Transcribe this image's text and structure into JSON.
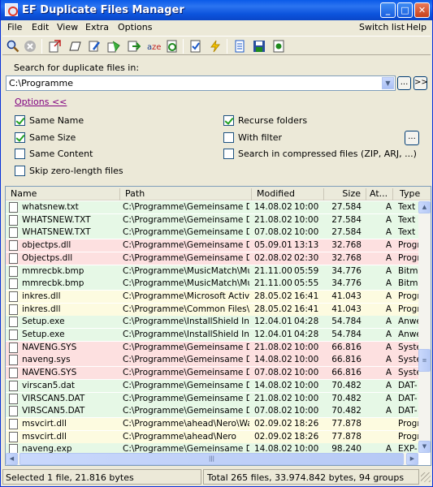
{
  "window": {
    "title": "EF Duplicate Files Manager"
  },
  "titlebar_buttons": {
    "minimize": "_",
    "maximize": "□",
    "close": "✕"
  },
  "menu": {
    "items": [
      "File",
      "Edit",
      "View",
      "Extra",
      "Options"
    ],
    "right_items": [
      "Switch list",
      "Help"
    ]
  },
  "toolbar": {
    "icons": [
      "search-icon",
      "stop-icon",
      "open-icon",
      "move-icon",
      "edit-icon",
      "copy-icon",
      "export-icon",
      "rename-icon",
      "refresh-icon",
      "checklist-icon",
      "lightning-icon",
      "document-icon",
      "save-icon",
      "properties-icon"
    ]
  },
  "search": {
    "label": "Search for duplicate files in:",
    "path": "C:\\Programme",
    "browse_label": "...",
    "go_label": ">>"
  },
  "options": {
    "toggle_label": "Options  <<",
    "same_name": {
      "label": "Same Name",
      "checked": true
    },
    "same_size": {
      "label": "Same Size",
      "checked": true
    },
    "same_content": {
      "label": "Same Content",
      "checked": false
    },
    "skip_zero": {
      "label": "Skip zero-length files",
      "checked": false
    },
    "recurse": {
      "label": "Recurse folders",
      "checked": true
    },
    "with_filter": {
      "label": "With filter",
      "checked": false
    },
    "compressed": {
      "label": "Search in compressed files (ZIP, ARJ, ...)",
      "checked": false
    },
    "filter_button": "..."
  },
  "list": {
    "columns": [
      "Name",
      "Path",
      "Modified",
      "Size",
      "At...",
      "Type"
    ],
    "rows": [
      {
        "name": "whatsnew.txt",
        "path": "C:\\Programme\\Gemeinsame Da...",
        "date": "14.08.02",
        "time": "10:00",
        "size": "27.584",
        "attr": "A",
        "type": "Text",
        "color": "#e6f8e6"
      },
      {
        "name": "WHATSNEW.TXT",
        "path": "C:\\Programme\\Gemeinsame Da...",
        "date": "21.08.02",
        "time": "10:00",
        "size": "27.584",
        "attr": "A",
        "type": "Text",
        "color": "#e6f8e6"
      },
      {
        "name": "WHATSNEW.TXT",
        "path": "C:\\Programme\\Gemeinsame Da...",
        "date": "07.08.02",
        "time": "10:00",
        "size": "27.584",
        "attr": "A",
        "type": "Text",
        "color": "#e6f8e6"
      },
      {
        "name": "objectps.dll",
        "path": "C:\\Programme\\Gemeinsame Da...",
        "date": "05.09.01",
        "time": "13:13",
        "size": "32.768",
        "attr": "A",
        "type": "Progr",
        "color": "#fde0e0"
      },
      {
        "name": "Objectps.dll",
        "path": "C:\\Programme\\Gemeinsame Da...",
        "date": "02.08.02",
        "time": "02:30",
        "size": "32.768",
        "attr": "A",
        "type": "Progr",
        "color": "#fde0e0"
      },
      {
        "name": "mmrecbk.bmp",
        "path": "C:\\Programme\\MusicMatch\\Mus...",
        "date": "21.11.00",
        "time": "05:59",
        "size": "34.776",
        "attr": "A",
        "type": "Bitma",
        "color": "#e6f8e6"
      },
      {
        "name": "mmrecbk.bmp",
        "path": "C:\\Programme\\MusicMatch\\Mus...",
        "date": "21.11.00",
        "time": "05:55",
        "size": "34.776",
        "attr": "A",
        "type": "Bitma",
        "color": "#e6f8e6"
      },
      {
        "name": "inkres.dll",
        "path": "C:\\Programme\\Microsoft Active...",
        "date": "28.05.02",
        "time": "16:41",
        "size": "41.043",
        "attr": "A",
        "type": "Progr",
        "color": "#fdfbe0"
      },
      {
        "name": "inkres.dll",
        "path": "C:\\Programme\\Common Files\\M...",
        "date": "28.05.02",
        "time": "16:41",
        "size": "41.043",
        "attr": "A",
        "type": "Progr",
        "color": "#fdfbe0"
      },
      {
        "name": "Setup.exe",
        "path": "C:\\Programme\\InstallShield Ins...",
        "date": "12.04.01",
        "time": "04:28",
        "size": "54.784",
        "attr": "A",
        "type": "Anwe",
        "color": "#e6f8e6"
      },
      {
        "name": "Setup.exe",
        "path": "C:\\Programme\\InstallShield Ins...",
        "date": "12.04.01",
        "time": "04:28",
        "size": "54.784",
        "attr": "A",
        "type": "Anwe",
        "color": "#e6f8e6"
      },
      {
        "name": "NAVENG.SYS",
        "path": "C:\\Programme\\Gemeinsame Da...",
        "date": "21.08.02",
        "time": "10:00",
        "size": "66.816",
        "attr": "A",
        "type": "Syste",
        "color": "#fde0e0"
      },
      {
        "name": "naveng.sys",
        "path": "C:\\Programme\\Gemeinsame Da...",
        "date": "14.08.02",
        "time": "10:00",
        "size": "66.816",
        "attr": "A",
        "type": "Syste",
        "color": "#fde0e0"
      },
      {
        "name": "NAVENG.SYS",
        "path": "C:\\Programme\\Gemeinsame Da...",
        "date": "07.08.02",
        "time": "10:00",
        "size": "66.816",
        "attr": "A",
        "type": "Syste",
        "color": "#fde0e0"
      },
      {
        "name": "virscan5.dat",
        "path": "C:\\Programme\\Gemeinsame Da...",
        "date": "14.08.02",
        "time": "10:00",
        "size": "70.482",
        "attr": "A",
        "type": "DAT-",
        "color": "#e6f8e6"
      },
      {
        "name": "VIRSCAN5.DAT",
        "path": "C:\\Programme\\Gemeinsame Da...",
        "date": "21.08.02",
        "time": "10:00",
        "size": "70.482",
        "attr": "A",
        "type": "DAT-",
        "color": "#e6f8e6"
      },
      {
        "name": "VIRSCAN5.DAT",
        "path": "C:\\Programme\\Gemeinsame Da...",
        "date": "07.08.02",
        "time": "10:00",
        "size": "70.482",
        "attr": "A",
        "type": "DAT-",
        "color": "#e6f8e6"
      },
      {
        "name": "msvcirt.dll",
        "path": "C:\\Programme\\ahead\\Nero\\Wa...",
        "date": "02.09.02",
        "time": "18:26",
        "size": "77.878",
        "attr": "",
        "type": "Progr",
        "color": "#fdfbe0"
      },
      {
        "name": "msvcirt.dll",
        "path": "C:\\Programme\\ahead\\Nero",
        "date": "02.09.02",
        "time": "18:26",
        "size": "77.878",
        "attr": "",
        "type": "Progr",
        "color": "#fdfbe0"
      },
      {
        "name": "naveng.exp",
        "path": "C:\\Programme\\Gemeinsame Da...",
        "date": "14.08.02",
        "time": "10:00",
        "size": "98.240",
        "attr": "A",
        "type": "EXP-",
        "color": "#e6f8e6"
      }
    ]
  },
  "status": {
    "left": "Selected 1 file, 21.816 bytes",
    "right": "Total 265 files, 33.974.842 bytes, 94 groups"
  }
}
